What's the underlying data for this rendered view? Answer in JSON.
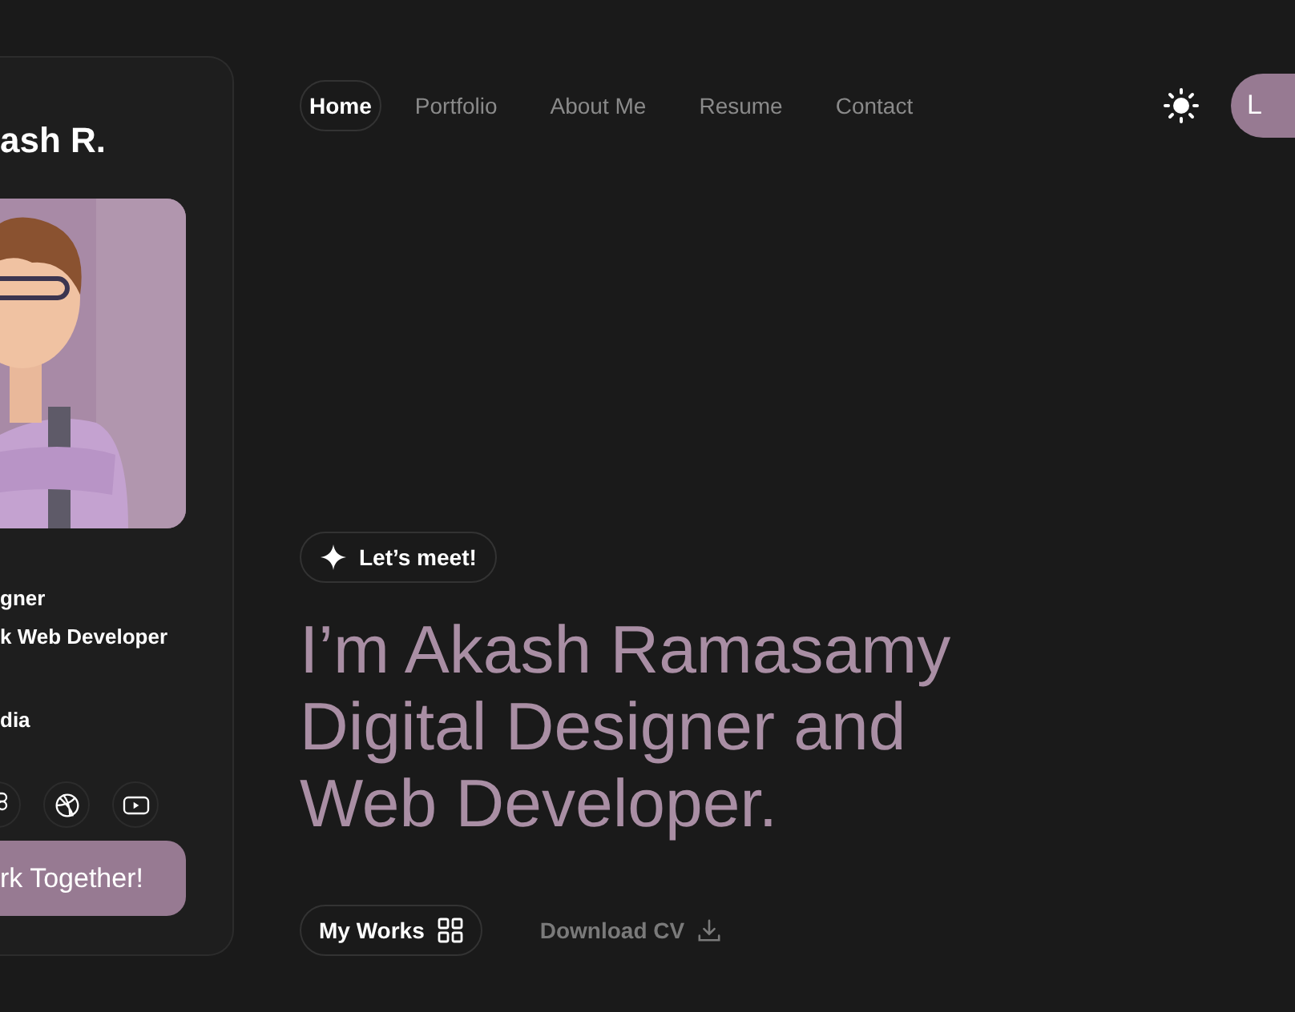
{
  "profile_card": {
    "name": "ash R.",
    "roles": [
      "gner",
      "k Web Developer"
    ],
    "location": "dia",
    "socials": [
      {
        "kind": "figma"
      },
      {
        "kind": "dribbble"
      },
      {
        "kind": "youtube"
      }
    ],
    "cta": "rk Together!"
  },
  "nav": [
    {
      "label": "Home",
      "selected": true
    },
    {
      "label": "Portfolio",
      "selected": false
    },
    {
      "label": "About Me",
      "selected": false
    },
    {
      "label": "Resume",
      "selected": false
    },
    {
      "label": "Contact",
      "selected": false
    }
  ],
  "avatar": {
    "initial": "L"
  },
  "hero": {
    "badge": "Let’s meet!",
    "headline": [
      "I’m Akash Ramasamy",
      "Digital Designer and",
      "Web Developer."
    ],
    "primary_button": "My Works",
    "secondary_button": "Download CV"
  }
}
